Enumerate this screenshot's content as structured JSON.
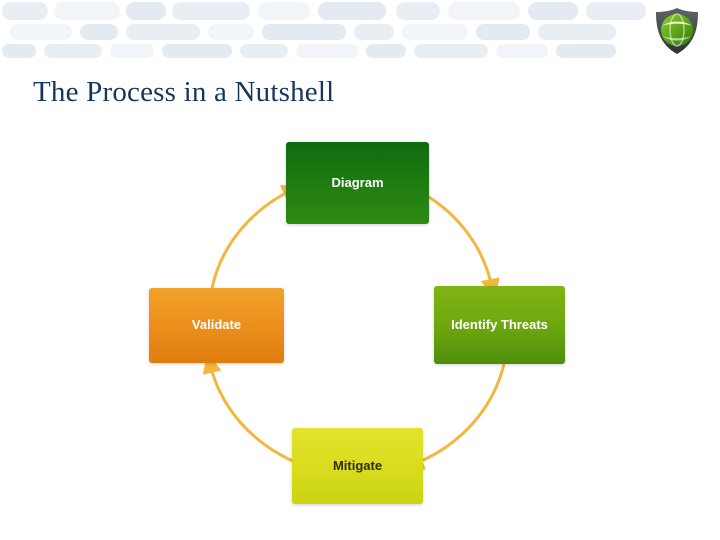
{
  "page": {
    "title": "The Process in a Nutshell",
    "background_color": "#ffffff",
    "title_color": "#17365d"
  },
  "header": {
    "logo_name": "shield-logo",
    "band_color": "#eef2f6"
  },
  "diagram": {
    "type": "cycle",
    "arrow_color": "#f4b63f",
    "direction": "clockwise",
    "nodes": [
      {
        "id": "diagram",
        "label": "Diagram",
        "position": "top",
        "color": "#1d7a10",
        "text_color": "#ffffff"
      },
      {
        "id": "identify-threats",
        "label": "Identify Threats",
        "position": "right",
        "color": "#6fa70f",
        "text_color": "#ffffff"
      },
      {
        "id": "mitigate",
        "label": "Mitigate",
        "position": "bottom",
        "color": "#d9dd1e",
        "text_color": "#2f2f00"
      },
      {
        "id": "validate",
        "label": "Validate",
        "position": "left",
        "color": "#ec8f1c",
        "text_color": "#ffffff"
      }
    ]
  }
}
